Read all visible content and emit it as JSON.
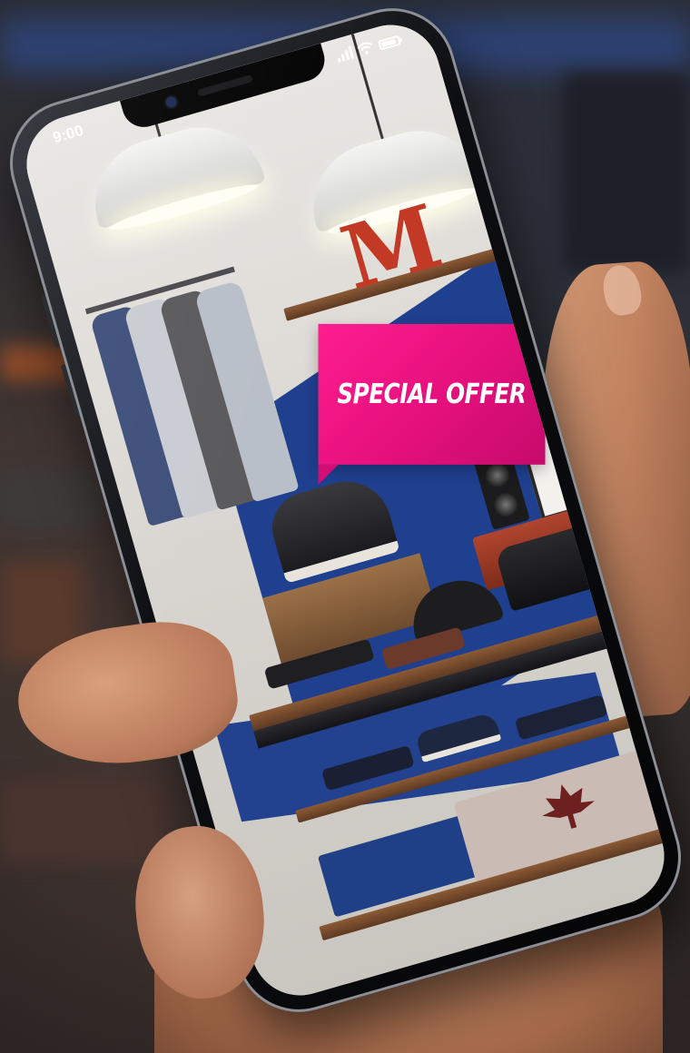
{
  "status_bar": {
    "time": "9:00",
    "icons": [
      "signal-icon",
      "wifi-icon",
      "battery-icon"
    ]
  },
  "promo": {
    "badge_text": "SPECIAL OFFER",
    "badge_color": "#e4107c"
  },
  "colors": {
    "background": "#1a1c22",
    "phone_frame": "#0d0e11",
    "accent": "#e4107c"
  }
}
